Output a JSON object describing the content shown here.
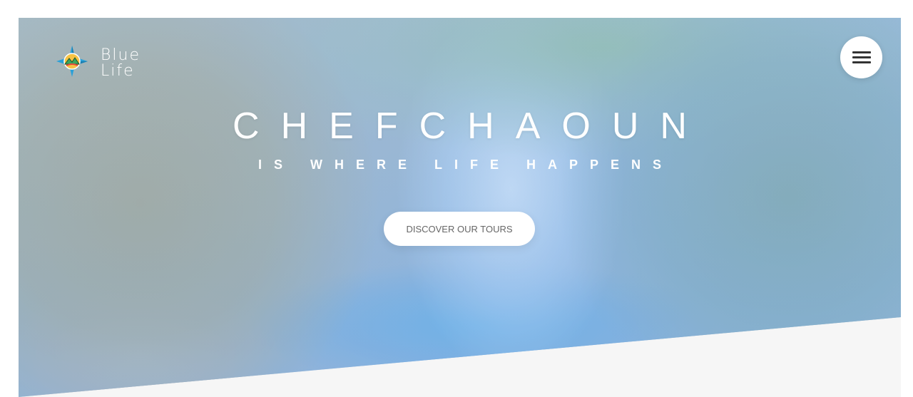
{
  "brand": {
    "logo_line1": "Blue",
    "logo_line2": "Life",
    "logo_icon": "mountain-emblem-icon"
  },
  "header": {
    "menu_icon": "hamburger-menu-icon"
  },
  "hero": {
    "title": "CHEFCHAOUN",
    "subtitle": "IS WHERE LIFE HAPPENS",
    "cta_label": "DISCOVER OUR TOURS"
  },
  "colors": {
    "cta_background": "#ffffff",
    "menu_background": "#ffffff",
    "section_background": "#f6f6f6"
  }
}
